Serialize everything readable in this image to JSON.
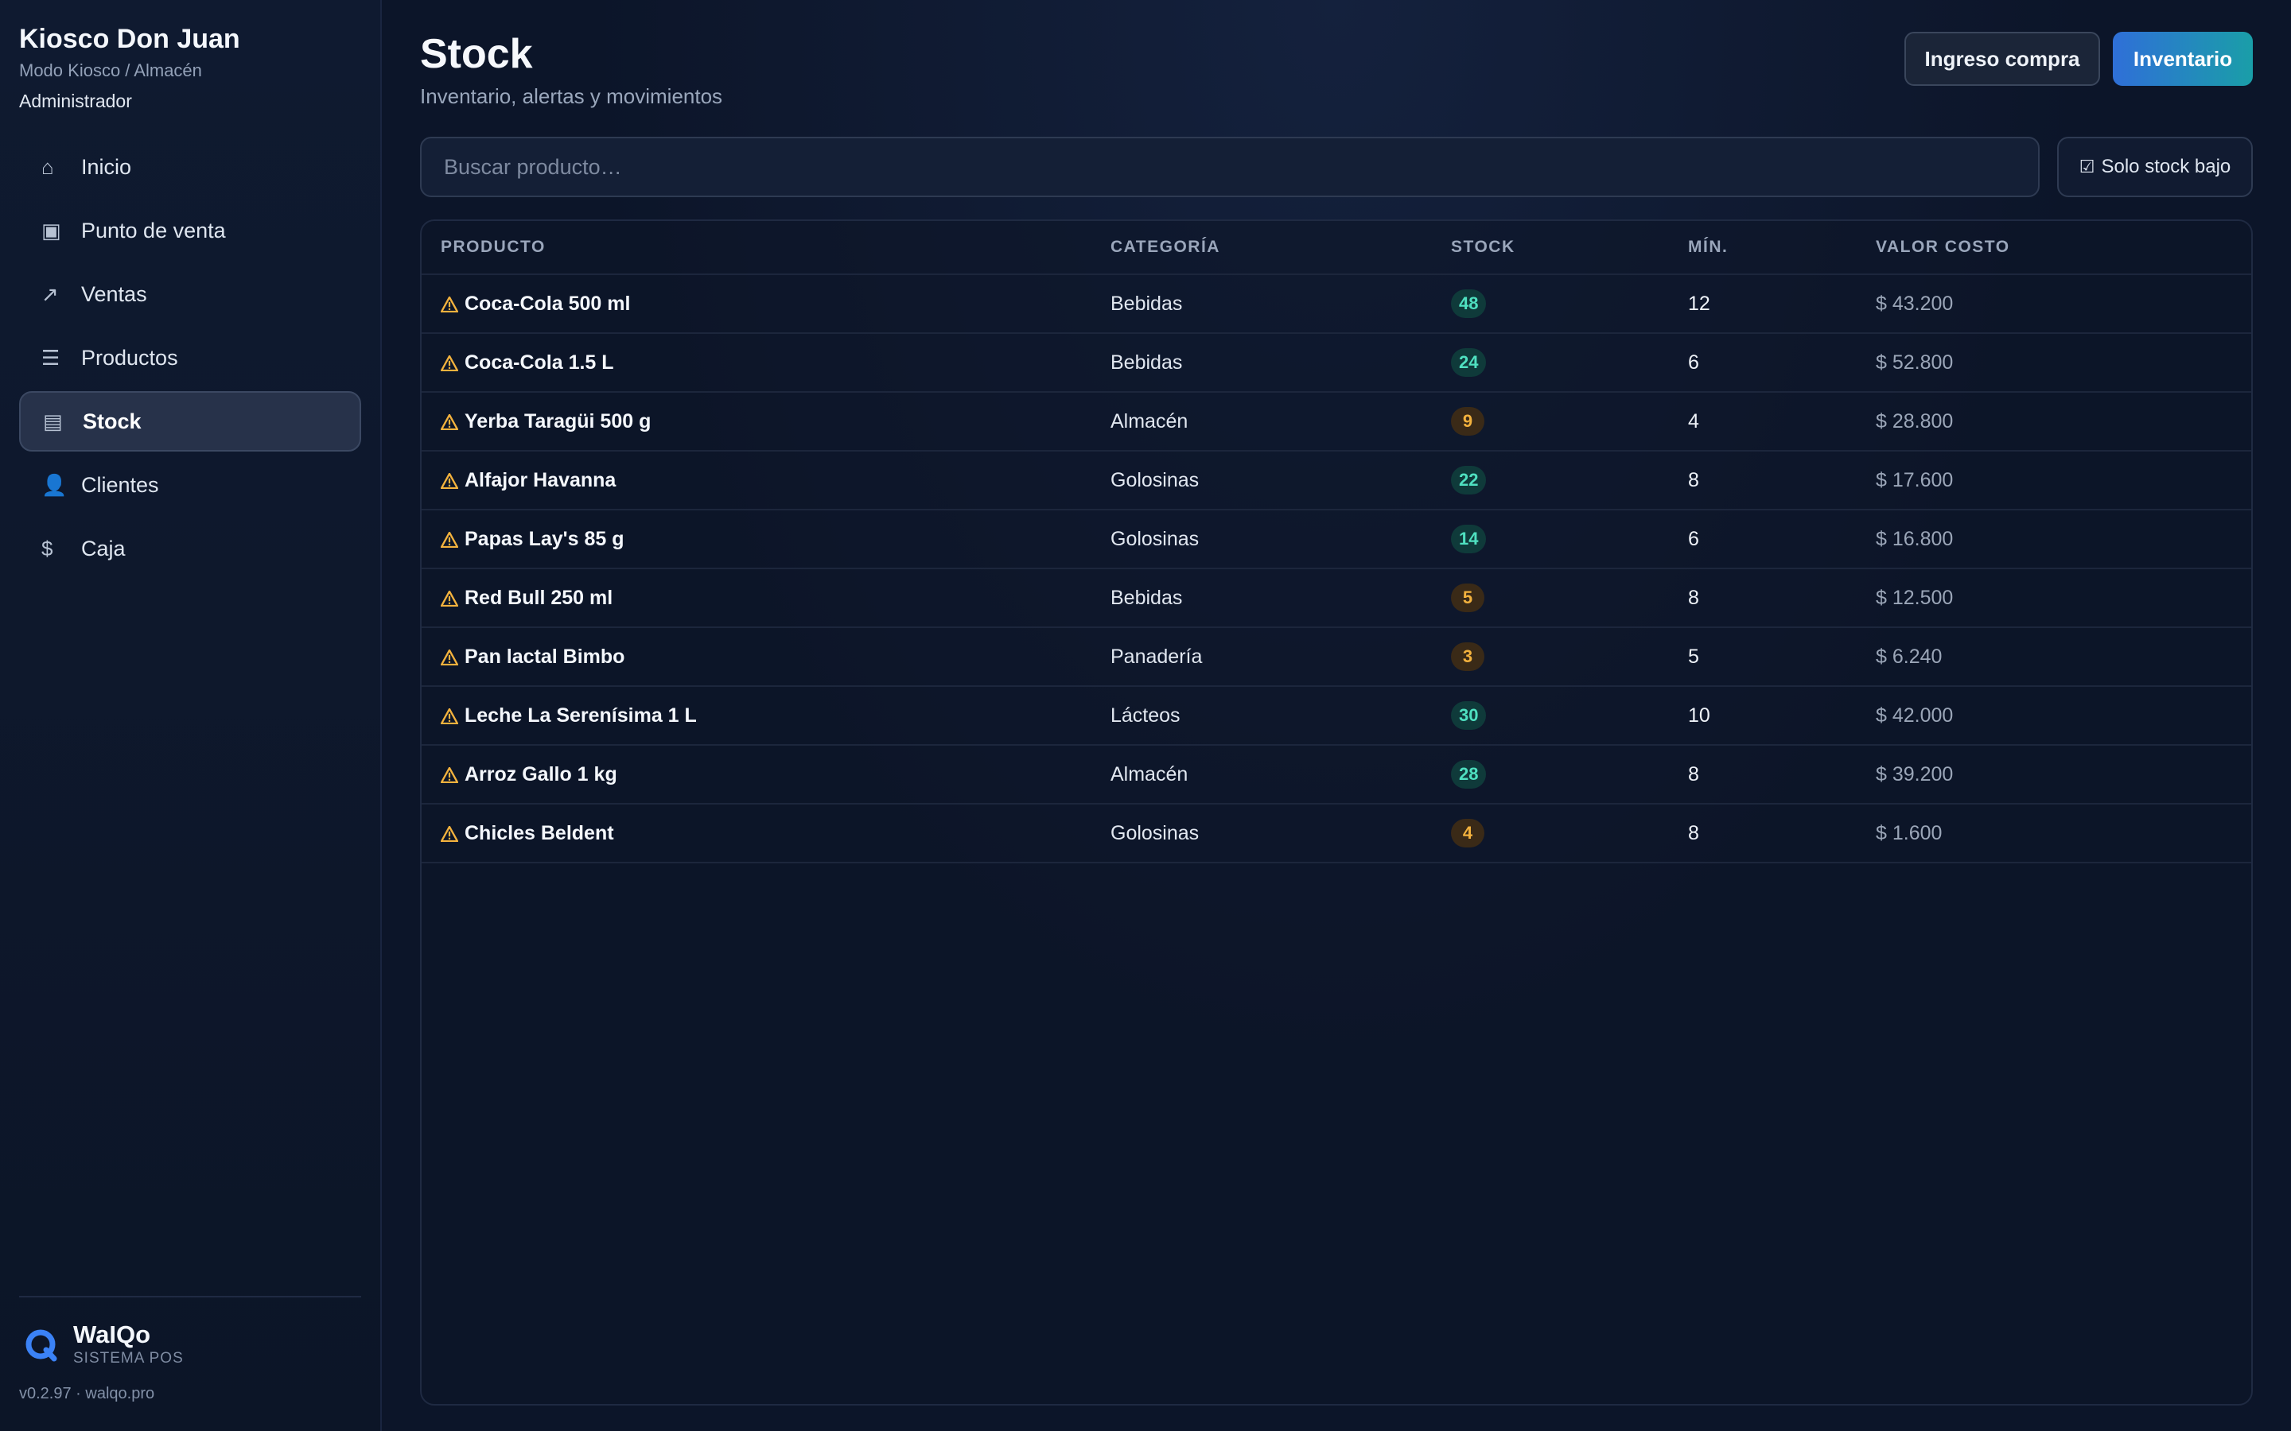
{
  "sidebar": {
    "brand_title": "Kiosco Don Juan",
    "brand_subtitle": "Modo Kiosco / Almacén",
    "role": "Administrador",
    "items": [
      {
        "label": "Inicio",
        "icon": "home-icon",
        "glyph": "⌂"
      },
      {
        "label": "Punto de venta",
        "icon": "pos-icon",
        "glyph": "▣"
      },
      {
        "label": "Ventas",
        "icon": "trend-icon",
        "glyph": "↗"
      },
      {
        "label": "Productos",
        "icon": "list-icon",
        "glyph": "☰"
      },
      {
        "label": "Stock",
        "icon": "stock-icon",
        "glyph": "▤"
      },
      {
        "label": "Clientes",
        "icon": "user-icon",
        "glyph": "👤"
      },
      {
        "label": "Caja",
        "icon": "dollar-icon",
        "glyph": "$"
      }
    ],
    "active_item": "Stock",
    "footer": {
      "logo_name": "WaIQo",
      "logo_tag": "SISTEMA POS",
      "version": "v0.2.97 · walqo.pro"
    }
  },
  "header": {
    "title": "Stock",
    "subtitle": "Inventario, alertas y movimientos",
    "secondary_button": "Ingreso compra",
    "primary_button": "Inventario"
  },
  "filters": {
    "search_placeholder": "Buscar producto…",
    "search_value": "",
    "low_stock_toggle": "Solo stock bajo",
    "low_stock_checked": true
  },
  "table": {
    "columns": [
      "PRODUCTO",
      "CATEGORÍA",
      "STOCK",
      "MÍN.",
      "VALOR COSTO"
    ],
    "rows": [
      {
        "product": "Coca-Cola 500 ml",
        "category": "Bebidas",
        "stock": "48",
        "min": "12",
        "cost": "$ 43.200",
        "level": "ok"
      },
      {
        "product": "Coca-Cola 1.5 L",
        "category": "Bebidas",
        "stock": "24",
        "min": "6",
        "cost": "$ 52.800",
        "level": "ok"
      },
      {
        "product": "Yerba Taragüi 500 g",
        "category": "Almacén",
        "stock": "9",
        "min": "4",
        "cost": "$ 28.800",
        "level": "low"
      },
      {
        "product": "Alfajor Havanna",
        "category": "Golosinas",
        "stock": "22",
        "min": "8",
        "cost": "$ 17.600",
        "level": "ok"
      },
      {
        "product": "Papas Lay's 85 g",
        "category": "Golosinas",
        "stock": "14",
        "min": "6",
        "cost": "$ 16.800",
        "level": "ok"
      },
      {
        "product": "Red Bull 250 ml",
        "category": "Bebidas",
        "stock": "5",
        "min": "8",
        "cost": "$ 12.500",
        "level": "low"
      },
      {
        "product": "Pan lactal Bimbo",
        "category": "Panadería",
        "stock": "3",
        "min": "5",
        "cost": "$ 6.240",
        "level": "low"
      },
      {
        "product": "Leche La Serenísima 1 L",
        "category": "Lácteos",
        "stock": "30",
        "min": "10",
        "cost": "$ 42.000",
        "level": "ok"
      },
      {
        "product": "Arroz Gallo 1 kg",
        "category": "Almacén",
        "stock": "28",
        "min": "8",
        "cost": "$ 39.200",
        "level": "ok"
      },
      {
        "product": "Chicles Beldent",
        "category": "Golosinas",
        "stock": "4",
        "min": "8",
        "cost": "$ 1.600",
        "level": "low"
      }
    ]
  },
  "colors": {
    "accent_start": "#2f6fd8",
    "accent_end": "#1a9ea8",
    "warning": "#f3b23e",
    "ok": "#4fe0c0"
  }
}
